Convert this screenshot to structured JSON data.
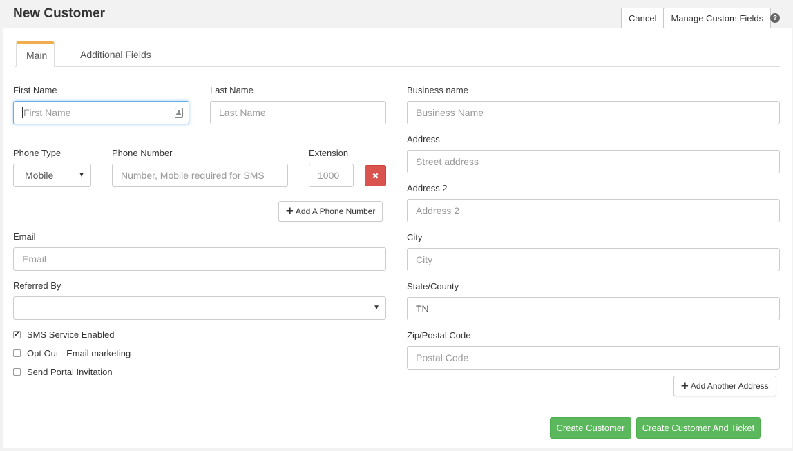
{
  "page": {
    "title": "New Customer",
    "cancel_label": "Cancel",
    "manage_fields_label": "Manage Custom Fields",
    "help_icon": "?"
  },
  "tabs": [
    {
      "label": "Main",
      "active": true
    },
    {
      "label": "Additional Fields",
      "active": false
    }
  ],
  "form": {
    "first_name": {
      "label": "First Name",
      "placeholder": "First Name",
      "value": ""
    },
    "last_name": {
      "label": "Last Name",
      "placeholder": "Last Name",
      "value": ""
    },
    "business_name": {
      "label": "Business name",
      "placeholder": "Business Name",
      "value": ""
    },
    "phone_type": {
      "label": "Phone Type",
      "value": "Mobile",
      "arrow": "▼"
    },
    "phone_number": {
      "label": "Phone Number",
      "placeholder": "Number, Mobile required for SMS",
      "value": ""
    },
    "extension": {
      "label": "Extension",
      "placeholder": "1000",
      "value": ""
    },
    "remove_phone_icon": "✖",
    "add_phone_label": "Add A Phone Number",
    "plus_icon": "✚",
    "email": {
      "label": "Email",
      "placeholder": "Email",
      "value": ""
    },
    "referred_by": {
      "label": "Referred By",
      "value": "",
      "arrow": "▼"
    },
    "address": {
      "label": "Address",
      "placeholder": "Street address",
      "value": ""
    },
    "address2": {
      "label": "Address 2",
      "placeholder": "Address 2",
      "value": ""
    },
    "city": {
      "label": "City",
      "placeholder": "City",
      "value": ""
    },
    "state": {
      "label": "State/County",
      "value": "TN"
    },
    "zip": {
      "label": "Zip/Postal Code",
      "placeholder": "Postal Code",
      "value": ""
    },
    "add_address_label": "Add Another Address",
    "checkboxes": [
      {
        "label": "SMS Service Enabled",
        "checked": true,
        "mark": "✔"
      },
      {
        "label": "Opt Out - Email marketing",
        "checked": false,
        "mark": ""
      },
      {
        "label": "Send Portal Invitation",
        "checked": false,
        "mark": ""
      }
    ]
  },
  "actions": {
    "create_customer": "Create Customer",
    "create_customer_ticket": "Create Customer And Ticket"
  },
  "colors": {
    "tab_accent": "#f0ad4e",
    "danger": "#d9534f",
    "success": "#5cb85c",
    "focus": "#66afe9"
  }
}
